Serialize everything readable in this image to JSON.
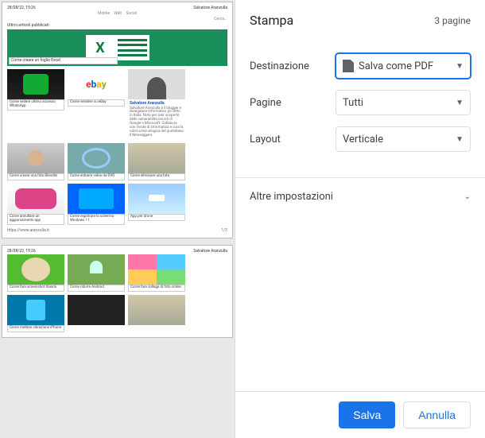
{
  "panel": {
    "title": "Stampa",
    "page_count": "3 pagine",
    "destination_label": "Destinazione",
    "destination_value": "Salva come PDF",
    "pages_label": "Pagine",
    "pages_value": "Tutti",
    "layout_label": "Layout",
    "layout_value": "Verticale",
    "more_settings": "Altre impostazioni",
    "save_button": "Salva",
    "cancel_button": "Annulla"
  },
  "preview": {
    "header_date": "28/08/22, 19:26",
    "header_author": "Salvatore Aranzulla",
    "nav": [
      "Mobile",
      "Web",
      "Social"
    ],
    "search": "Cerca...",
    "subhead": "Ultimi articoli pubblicati:",
    "hero": {
      "caption": "Come creare un foglio Excel"
    },
    "author_name": "Salvatore Aranzulla",
    "author_blurb": "Salvatore Aranzulla è il blogger e divulgatore informatico più letto in Italia. Noto per aver scoperto delle vulnerabilità nei siti di Google e Microsoft. Collabora con riviste di informatica e cura la rubrica tecnologica del quotidiano Il Messaggero.",
    "footer_url": "https://www.aranzulla.it",
    "footer_page": "1/3",
    "tiles_p1": [
      {
        "caption": "Come vedere ultimo accesso WhatsApp",
        "art": "t-phone"
      },
      {
        "caption": "Come vendere su eBay",
        "art": "t-ebay"
      },
      {
        "caption": "Come creare una foto Blendlin",
        "art": "t-man"
      },
      {
        "caption": "Come estrarre video da DVD",
        "art": "t-disc"
      },
      {
        "caption": "Come eliminare una foto",
        "art": "t-room"
      },
      {
        "caption": "Come annullare un aggiornamento app",
        "art": "t-people"
      },
      {
        "caption": "Come registrare lo schermo Windows 11",
        "art": "t-monitor"
      },
      {
        "caption": "App per drone",
        "art": "t-drone"
      }
    ],
    "header_date2": "28/08/22, 19:26",
    "tiles_p2": [
      {
        "caption": "Come fare screenshot Xiaomi",
        "art": "t-latte"
      },
      {
        "caption": "Come ridurre Android",
        "art": "t-android"
      },
      {
        "caption": "Come fare collage di foto online",
        "art": "t-collage"
      },
      {
        "caption": "Come mettere vibrazione iPhone",
        "art": "t-vib"
      },
      {
        "caption": "",
        "art": "t-dark"
      },
      {
        "caption": "",
        "art": "t-room"
      }
    ]
  }
}
